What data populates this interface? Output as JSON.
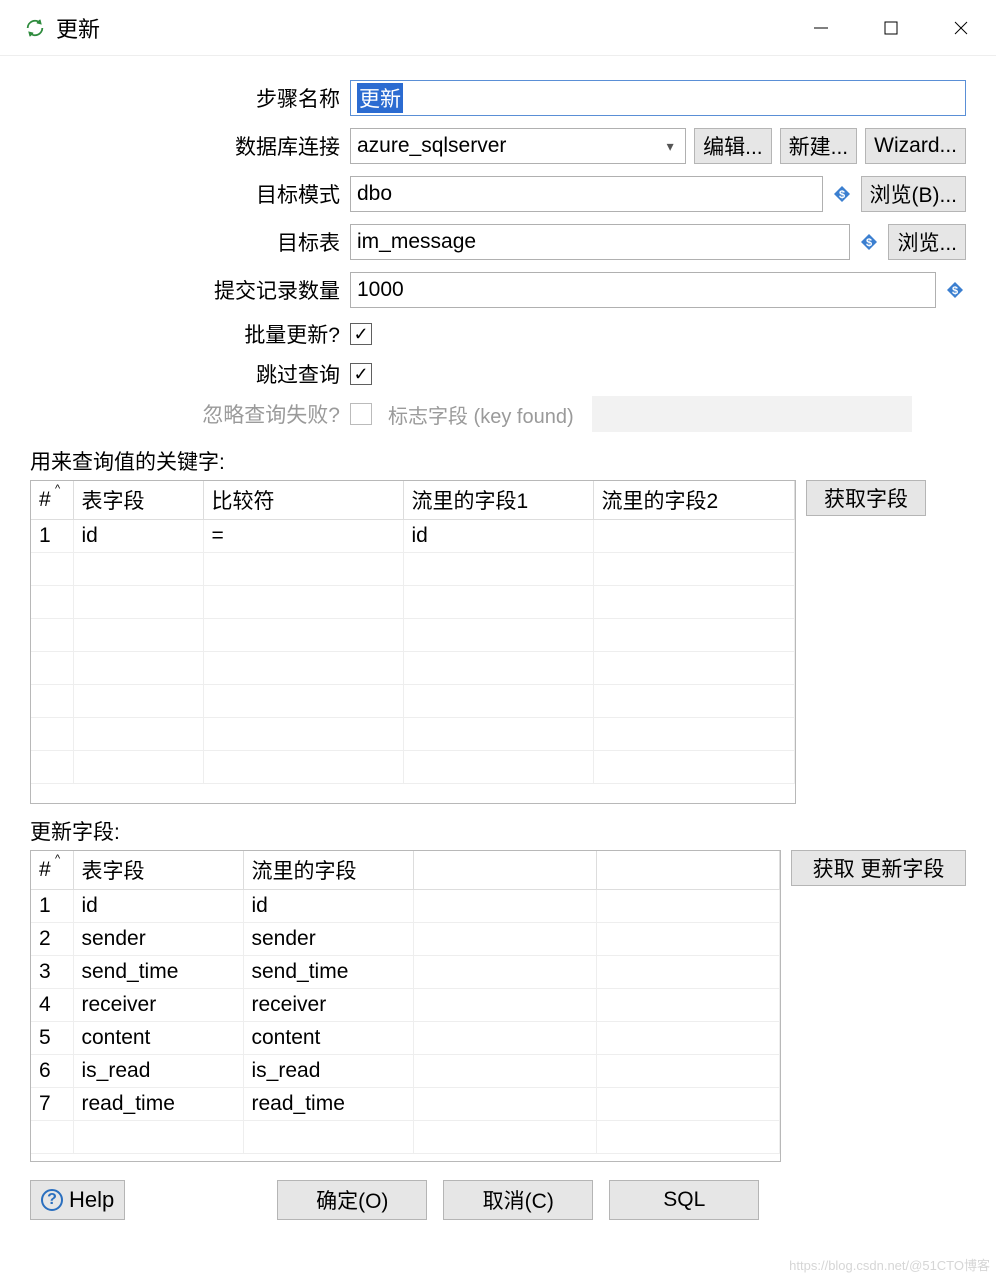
{
  "window": {
    "title": "更新"
  },
  "form": {
    "step_name_label": "步骤名称",
    "step_name_value": "更新",
    "db_conn_label": "数据库连接",
    "db_conn_value": "azure_sqlserver",
    "edit_btn": "编辑...",
    "new_btn": "新建...",
    "wizard_btn": "Wizard...",
    "target_schema_label": "目标模式",
    "target_schema_value": "dbo",
    "browse_b_btn": "浏览(B)...",
    "target_table_label": "目标表",
    "target_table_value": "im_message",
    "browse_btn": "浏览...",
    "commit_size_label": "提交记录数量",
    "commit_size_value": "1000",
    "batch_update_label": "批量更新?",
    "skip_lookup_label": "跳过查询",
    "ignore_fail_label": "忽略查询失败?",
    "flag_field_label": "标志字段 (key found)"
  },
  "key_table": {
    "title": "用来查询值的关键字:",
    "headers": {
      "num": "#",
      "tfield": "表字段",
      "cmp": "比较符",
      "sfield1": "流里的字段1",
      "sfield2": "流里的字段2"
    },
    "rows": [
      {
        "num": "1",
        "tfield": "id",
        "cmp": "=",
        "sfield1": "id",
        "sfield2": ""
      }
    ],
    "get_fields_btn": "获取字段"
  },
  "update_table": {
    "title": "更新字段:",
    "headers": {
      "num": "#",
      "tfield": "表字段",
      "sfield": "流里的字段"
    },
    "rows": [
      {
        "num": "1",
        "tfield": "id",
        "sfield": "id"
      },
      {
        "num": "2",
        "tfield": "sender",
        "sfield": "sender"
      },
      {
        "num": "3",
        "tfield": "send_time",
        "sfield": "send_time"
      },
      {
        "num": "4",
        "tfield": "receiver",
        "sfield": "receiver"
      },
      {
        "num": "5",
        "tfield": "content",
        "sfield": "content"
      },
      {
        "num": "6",
        "tfield": "is_read",
        "sfield": "is_read"
      },
      {
        "num": "7",
        "tfield": "read_time",
        "sfield": "read_time"
      }
    ],
    "get_update_fields_btn": "获取 更新字段"
  },
  "footer": {
    "help": "Help",
    "ok": "确定(O)",
    "cancel": "取消(C)",
    "sql": "SQL"
  },
  "watermark": "https://blog.csdn.net/@51CTO博客"
}
